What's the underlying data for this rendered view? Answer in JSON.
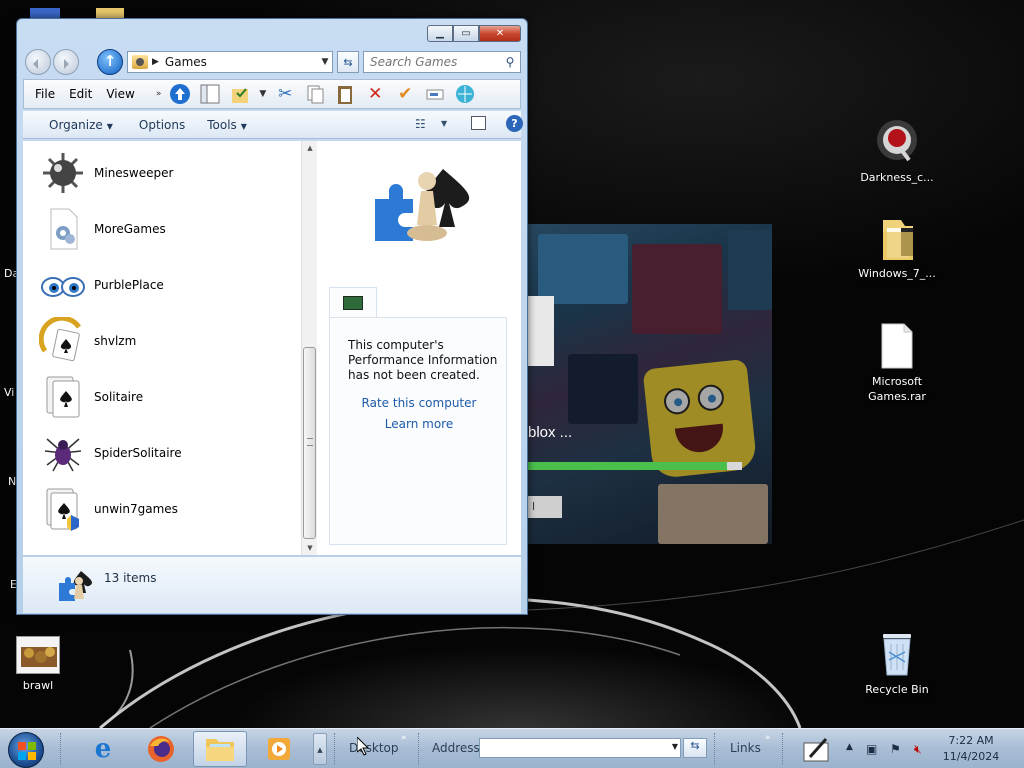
{
  "desktop": {
    "icons": [
      {
        "id": "darkness",
        "label": "Darkness_c..."
      },
      {
        "id": "windows7",
        "label": "Windows_7_..."
      },
      {
        "id": "msgames",
        "label": "Microsoft Games.rar"
      },
      {
        "id": "recycle",
        "label": "Recycle Bin"
      },
      {
        "id": "brawl",
        "label": "brawl"
      }
    ],
    "edge_fragments": [
      "Da",
      "Vi",
      "N",
      "E"
    ]
  },
  "background_app": {
    "loading_text": "blox ...",
    "progress_fraction": 0.93,
    "button_fragment": "l"
  },
  "explorer": {
    "address": {
      "crumb": "Games"
    },
    "search": {
      "placeholder": "Search Games"
    },
    "menu": [
      "File",
      "Edit",
      "View"
    ],
    "commands": {
      "organize": "Organize",
      "options": "Options",
      "tools": "Tools"
    },
    "items": [
      {
        "name": "Minesweeper",
        "icon": "minesweeper-icon"
      },
      {
        "name": "MoreGames",
        "icon": "moregames-icon"
      },
      {
        "name": "PurblePlace",
        "icon": "purbleplace-icon"
      },
      {
        "name": "shvlzm",
        "icon": "shvlzm-icon"
      },
      {
        "name": "Solitaire",
        "icon": "solitaire-icon"
      },
      {
        "name": "SpiderSolitaire",
        "icon": "spidersolitaire-icon"
      },
      {
        "name": "unwin7games",
        "icon": "unwin7games-icon"
      }
    ],
    "preview": {
      "perf_text": "This computer's Performance Information has not been created.",
      "rate_link": "Rate this computer",
      "learn_link": "Learn more"
    },
    "details": {
      "count": "13 items"
    }
  },
  "taskbar": {
    "desktop_label": "Desktop",
    "address_label": "Address",
    "links_label": "Links",
    "clock_time": "7:22 AM",
    "clock_date": "11/4/2024"
  },
  "colors": {
    "accent": "#1e5aa8",
    "progress": "#4bbf4b",
    "close_button": "#c8482f"
  }
}
